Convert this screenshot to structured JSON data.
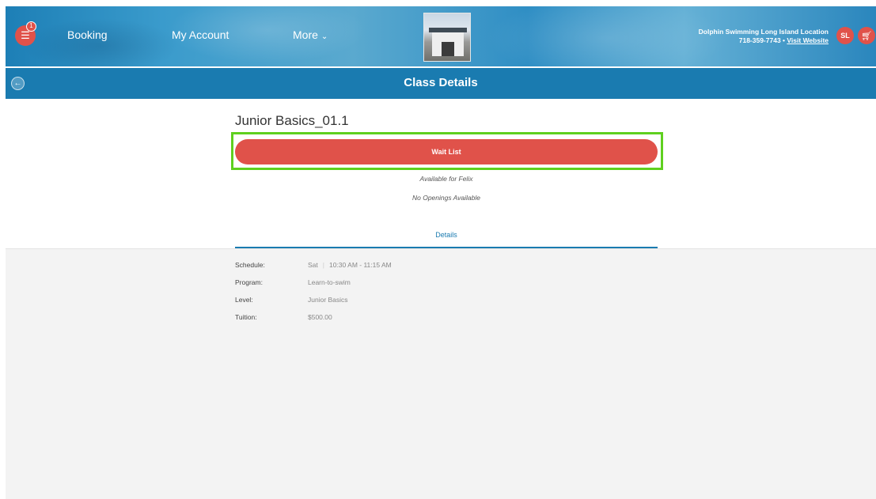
{
  "header": {
    "notification_count": "1",
    "nav": {
      "booking": "Booking",
      "my_account": "My Account",
      "more": "More"
    },
    "location": {
      "name": "Dolphin Swimming Long Island Location",
      "phone": "718-359-7743",
      "separator": "•",
      "visit_website": "Visit Website"
    },
    "avatar_initials": "SL",
    "icons": {
      "menu": "menu-icon",
      "chevron": "chevron-down-icon",
      "cart": "cart-icon"
    }
  },
  "titlebar": {
    "title": "Class Details",
    "back_icon": "back-arrow-icon"
  },
  "class": {
    "name": "Junior Basics_01.1",
    "action_label": "Wait List",
    "availability": "Available for Felix",
    "openings": "No Openings Available"
  },
  "tabs": {
    "details": "Details"
  },
  "details": {
    "schedule_label": "Schedule:",
    "schedule_day": "Sat",
    "schedule_time": "10:30 AM - 11:15 AM",
    "program_label": "Program:",
    "program_value": "Learn-to-swim",
    "level_label": "Level:",
    "level_value": "Junior Basics",
    "tuition_label": "Tuition:",
    "tuition_value": "$500.00"
  },
  "colors": {
    "brand_blue": "#1a7bb0",
    "action_red": "#e0524a",
    "highlight_green": "#5fd01f"
  }
}
